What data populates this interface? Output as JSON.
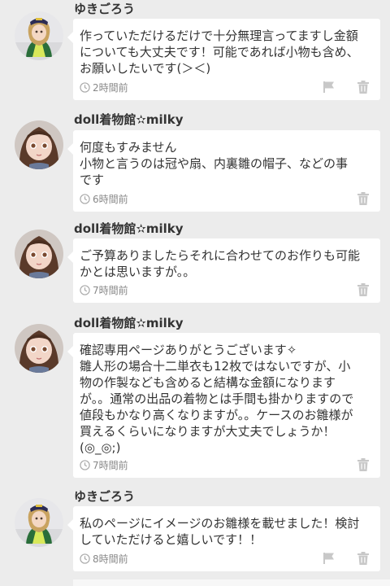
{
  "comments": [
    {
      "username": "ゆきごろう",
      "text": "作っていただけるだけで十分無理言ってますし金額\nについても大丈夫です！可能であれば小物も含め、\nお願いしたいです(＞＜)",
      "time": "2時間前",
      "avatar": "doll-avatar-yuki"
    },
    {
      "username": "doll着物館✫milky",
      "text": "何度もすみません\n小物と言うのは冠や扇、内裏雛の帽子、などの事\nです",
      "time": "6時間前",
      "avatar": "doll-avatar-milky"
    },
    {
      "username": "doll着物館✫milky",
      "text": "ご予算ありましたらそれに合わせてのお作りも可能\nかとは思いますが。。",
      "time": "7時間前",
      "avatar": "doll-avatar-milky"
    },
    {
      "username": "doll着物館✫milky",
      "text": "確認専用ページありがとうございます✧\n雛人形の場合十二単衣も12枚ではないですが、小\n物の作製なども含めると結構な金額になります\nが。。通常の出品の着物とは手間も掛かりますので\n値段もかなり高くなりますが。。ケースのお雛様が\n買えるくらいになりますが大丈夫でしょうか！\n(◎_◎;)",
      "time": "7時間前",
      "avatar": "doll-avatar-milky"
    },
    {
      "username": "ゆきごろう",
      "text": "私のページにイメージのお雛様を載せました！検討\nしていただけると嬉しいです！！",
      "time": "8時間前",
      "avatar": "doll-avatar-yuki"
    }
  ],
  "icons": {
    "clock": "clock-icon",
    "flag": "flag-icon",
    "trash": "trash-icon"
  },
  "colors": {
    "background": "#ececec",
    "bubble": "#ffffff",
    "text": "#333333",
    "meta": "#888888",
    "icon": "#c8c8c8"
  }
}
